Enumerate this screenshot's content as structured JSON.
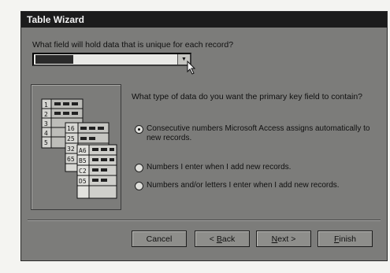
{
  "window": {
    "title": "Table Wizard"
  },
  "question1": "What field will hold data that is unique for each record?",
  "field_combo": {
    "value": ""
  },
  "question2": "What type of data do you want the primary key field to contain?",
  "options": [
    {
      "label": "Consecutive numbers Microsoft Access assigns automatically to new records.",
      "selected": true
    },
    {
      "label": "Numbers I enter when I add new records.",
      "selected": false
    },
    {
      "label": "Numbers and/or letters I enter when I add new records.",
      "selected": false
    }
  ],
  "illustration": {
    "row_numbers": [
      "1",
      "2",
      "3",
      "4",
      "5"
    ],
    "col_values": [
      "16",
      "25",
      "32",
      "65"
    ],
    "codes": [
      "A6",
      "B5",
      "C2",
      "D5"
    ]
  },
  "buttons": {
    "cancel": "Cancel",
    "back": {
      "pre": "< ",
      "key": "B",
      "rest": "ack"
    },
    "next": {
      "key": "N",
      "rest": "ext >"
    },
    "finish": {
      "key": "F",
      "rest": "inish"
    }
  }
}
